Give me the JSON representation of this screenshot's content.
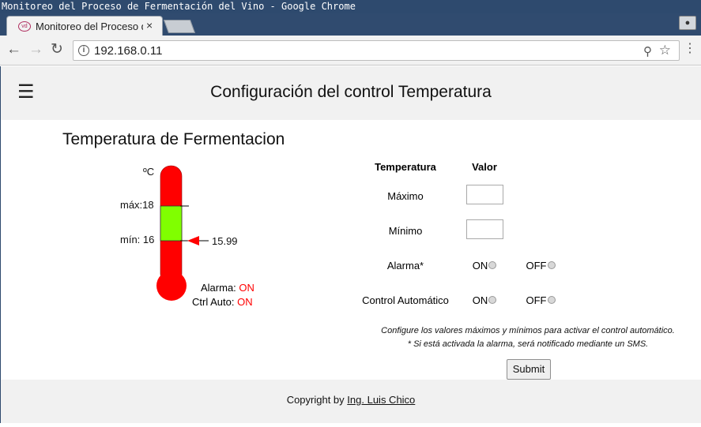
{
  "window": {
    "title": "Monitoreo del Proceso de Fermentación del Vino - Google Chrome"
  },
  "browser": {
    "tab_title": "Monitoreo del Proceso de Fermentación del Vino",
    "tab_favicon": "vd",
    "url": "192.168.0.11",
    "icons": [
      "back-arrow-icon",
      "forward-arrow-icon",
      "reload-icon",
      "info-icon",
      "zoom-icon",
      "star-icon",
      "menu-dots-icon",
      "close-icon",
      "profile-icon"
    ]
  },
  "header": {
    "menu_icon": "☰",
    "title": "Configuración del control Temperatura"
  },
  "main": {
    "section_title": "Temperatura de Fermentacion",
    "thermometer": {
      "unit": "ºC",
      "max_label": "máx:18",
      "min_label": "mín: 16",
      "current_value": "15.99",
      "max": 18,
      "min": 16,
      "current": 15.99,
      "alarm_label": "Alarma:",
      "alarm_value": "ON",
      "ctrl_label": "Ctrl Auto:",
      "ctrl_value": "ON",
      "colors": {
        "body": "#ff0000",
        "range": "#80ff00",
        "status": "#ff0000"
      }
    },
    "config": {
      "headers": [
        "Temperatura",
        "Valor"
      ],
      "rows": {
        "max_label": "Máximo",
        "max_value": "",
        "min_label": "Mínimo",
        "min_value": "",
        "alarm_label": "Alarma*",
        "ctrl_label": "Control Automático",
        "on_label": "ON",
        "off_label": "OFF"
      },
      "note1": "Configure los valores máximos y mínimos para activar el control automático.",
      "note2": "* Si está activada la alarma, será notificado mediante un SMS.",
      "submit_label": "Submit"
    }
  },
  "footer": {
    "prefix": "Copyright by",
    "author": "Ing. Luis Chico"
  }
}
